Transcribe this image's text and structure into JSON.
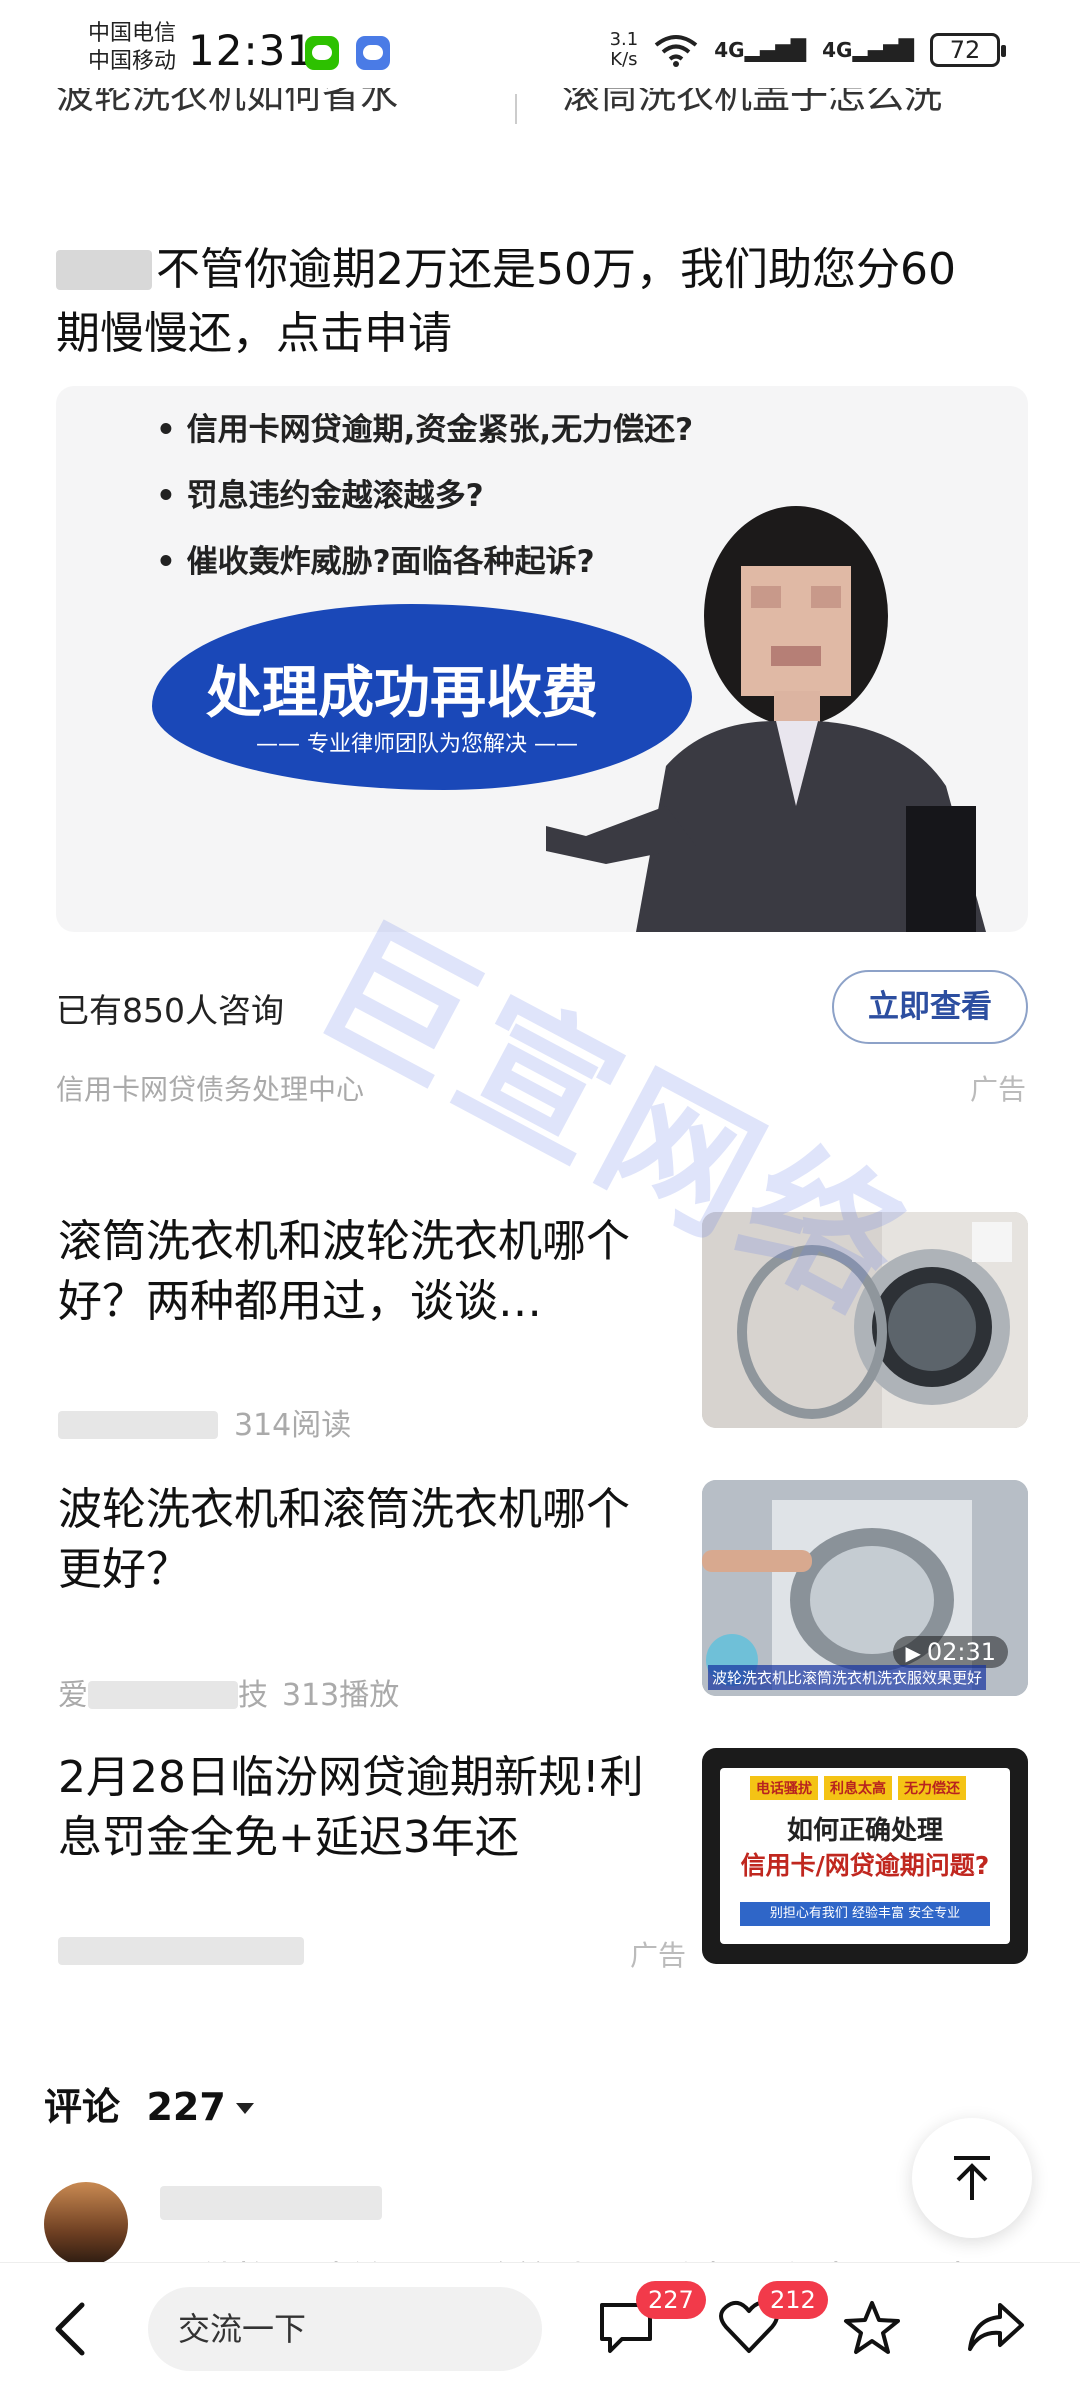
{
  "status_bar": {
    "carrier_1": "中国电信",
    "carrier_2": "中国移动",
    "time": "12:31",
    "net_speed_value": "3.1",
    "net_speed_unit": "K/s",
    "signal_1": "4G",
    "signal_2": "4G",
    "battery": "72"
  },
  "related_topics": {
    "left": "波轮洗衣机如何省水",
    "right": "滚筒洗衣机盖子怎么洗"
  },
  "ad_card": {
    "title": "不管你逾期2万还是50万，我们助您分60期慢慢还，点击申请",
    "bullets": [
      "信用卡网贷逾期,资金紧张,无力偿还?",
      "罚息违约金越滚越多?",
      "催收轰炸威胁?面临各种起诉?"
    ],
    "banner_title": "处理成功再收费",
    "banner_subtitle": "—— 专业律师团队为您解决 ——",
    "consult_count": "已有850人咨询",
    "cta_label": "立即查看",
    "source": "信用卡网贷债务处理中心",
    "ad_label": "广告"
  },
  "watermark": "巨宣网络",
  "feed": [
    {
      "title": "滚筒洗衣机和波轮洗衣机哪个好？两种都用过，谈谈…",
      "meta": "314阅读",
      "thumb_icon": "front-load-washer-photo"
    },
    {
      "title": "波轮洗衣机和滚筒洗衣机哪个更好？",
      "author_prefix": "爱",
      "author_suffix": "技",
      "meta": "313播放",
      "duration": "02:31",
      "thumb_caption": "波轮洗衣机比滚筒洗衣机洗衣服效果更好",
      "thumb_icon": "top-load-washer-photo"
    },
    {
      "title": "2月28日临汾网贷逾期新规!利息罚金全免+延迟3年还",
      "ad_label": "广告",
      "slide_tags": [
        "电话骚扰",
        "利息太高",
        "无力偿还"
      ],
      "slide_line1": "如何正确处理",
      "slide_line2": "信用卡/网贷逾期问题?",
      "slide_band": "别担心有我们  经验丰富  安全专业"
    }
  ],
  "comments": {
    "label": "评论",
    "count": "227",
    "first_comment_text": "早就换回波轮了😅 滚筒洗不干净操作复杂遇到佳"
  },
  "bottom_bar": {
    "input_placeholder": "交流一下",
    "comment_badge": "227",
    "like_badge": "212"
  },
  "colors": {
    "accent_blue": "#1a48b8",
    "badge_red": "#f23a4a",
    "cta_text": "#2c4ea0"
  }
}
